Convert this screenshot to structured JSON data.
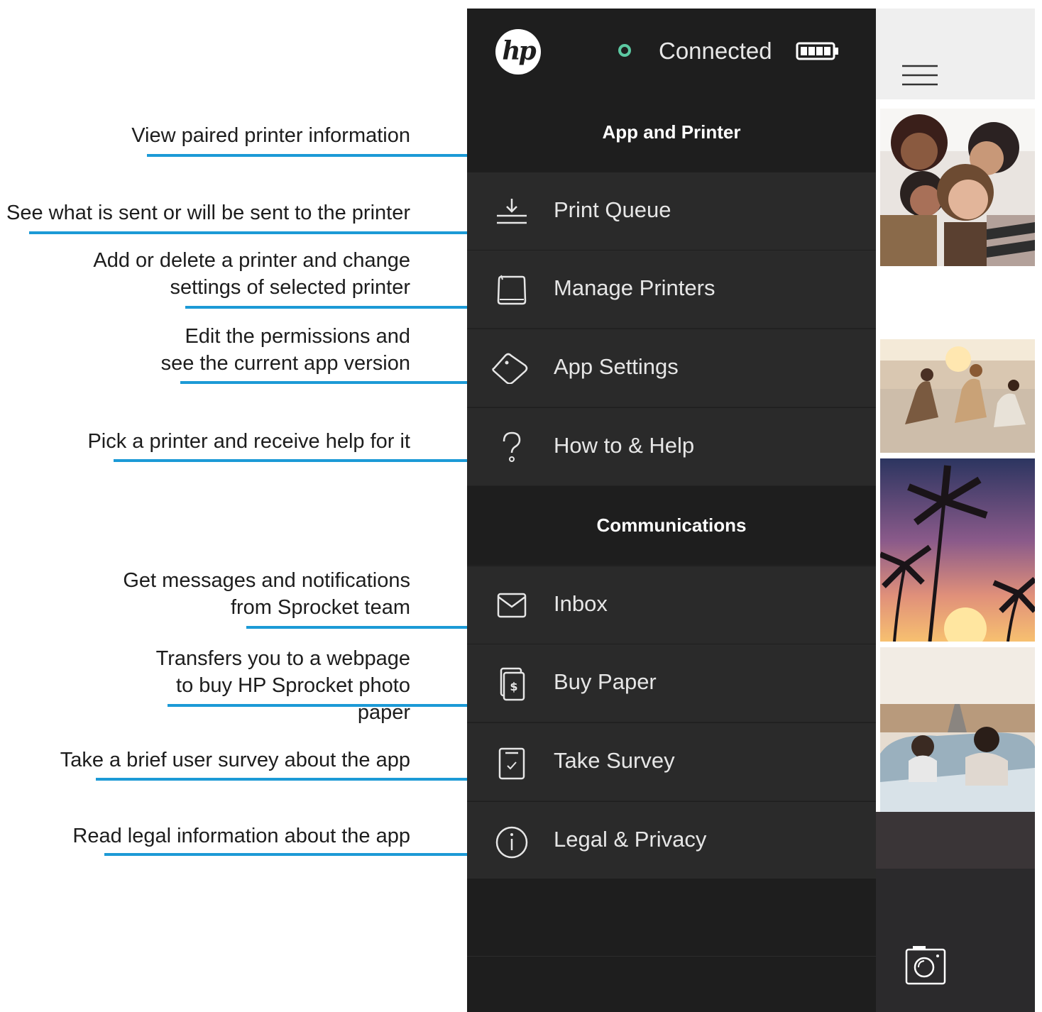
{
  "annotations": [
    "View paired printer information",
    "See what is sent or will be sent to the printer",
    "Add or delete a printer and change settings of selected printer",
    "Edit the permissions and see the current app version",
    "Pick a printer and receive help for it",
    "Get messages and notifications from Sprocket team",
    "Transfers you to a webpage to buy HP Sprocket photo paper",
    "Take a brief user survey about the app",
    "Read legal information about the app"
  ],
  "header": {
    "logo_text": "hp",
    "status": "Connected",
    "status_color": "#5cc9a2",
    "battery_icon": "battery-full-icon"
  },
  "sections": {
    "app_and_printer": "App and Printer",
    "communications": "Communications"
  },
  "menu_items": [
    {
      "label": "Print Queue",
      "icon": "print-queue-icon"
    },
    {
      "label": "Manage Printers",
      "icon": "printer-icon"
    },
    {
      "label": "App Settings",
      "icon": "diamond-settings-icon"
    },
    {
      "label": "How to & Help",
      "icon": "question-mark-icon"
    },
    {
      "label": "Inbox",
      "icon": "envelope-icon"
    },
    {
      "label": "Buy Paper",
      "icon": "paper-dollar-icon"
    },
    {
      "label": "Take Survey",
      "icon": "clipboard-check-icon"
    },
    {
      "label": "Legal & Privacy",
      "icon": "info-icon"
    }
  ],
  "colors": {
    "accent_leader": "#1c9ad6",
    "menu_background": "#232323"
  },
  "strip": {
    "menu_icon": "hamburger-menu-icon",
    "camera_icon": "camera-icon"
  }
}
